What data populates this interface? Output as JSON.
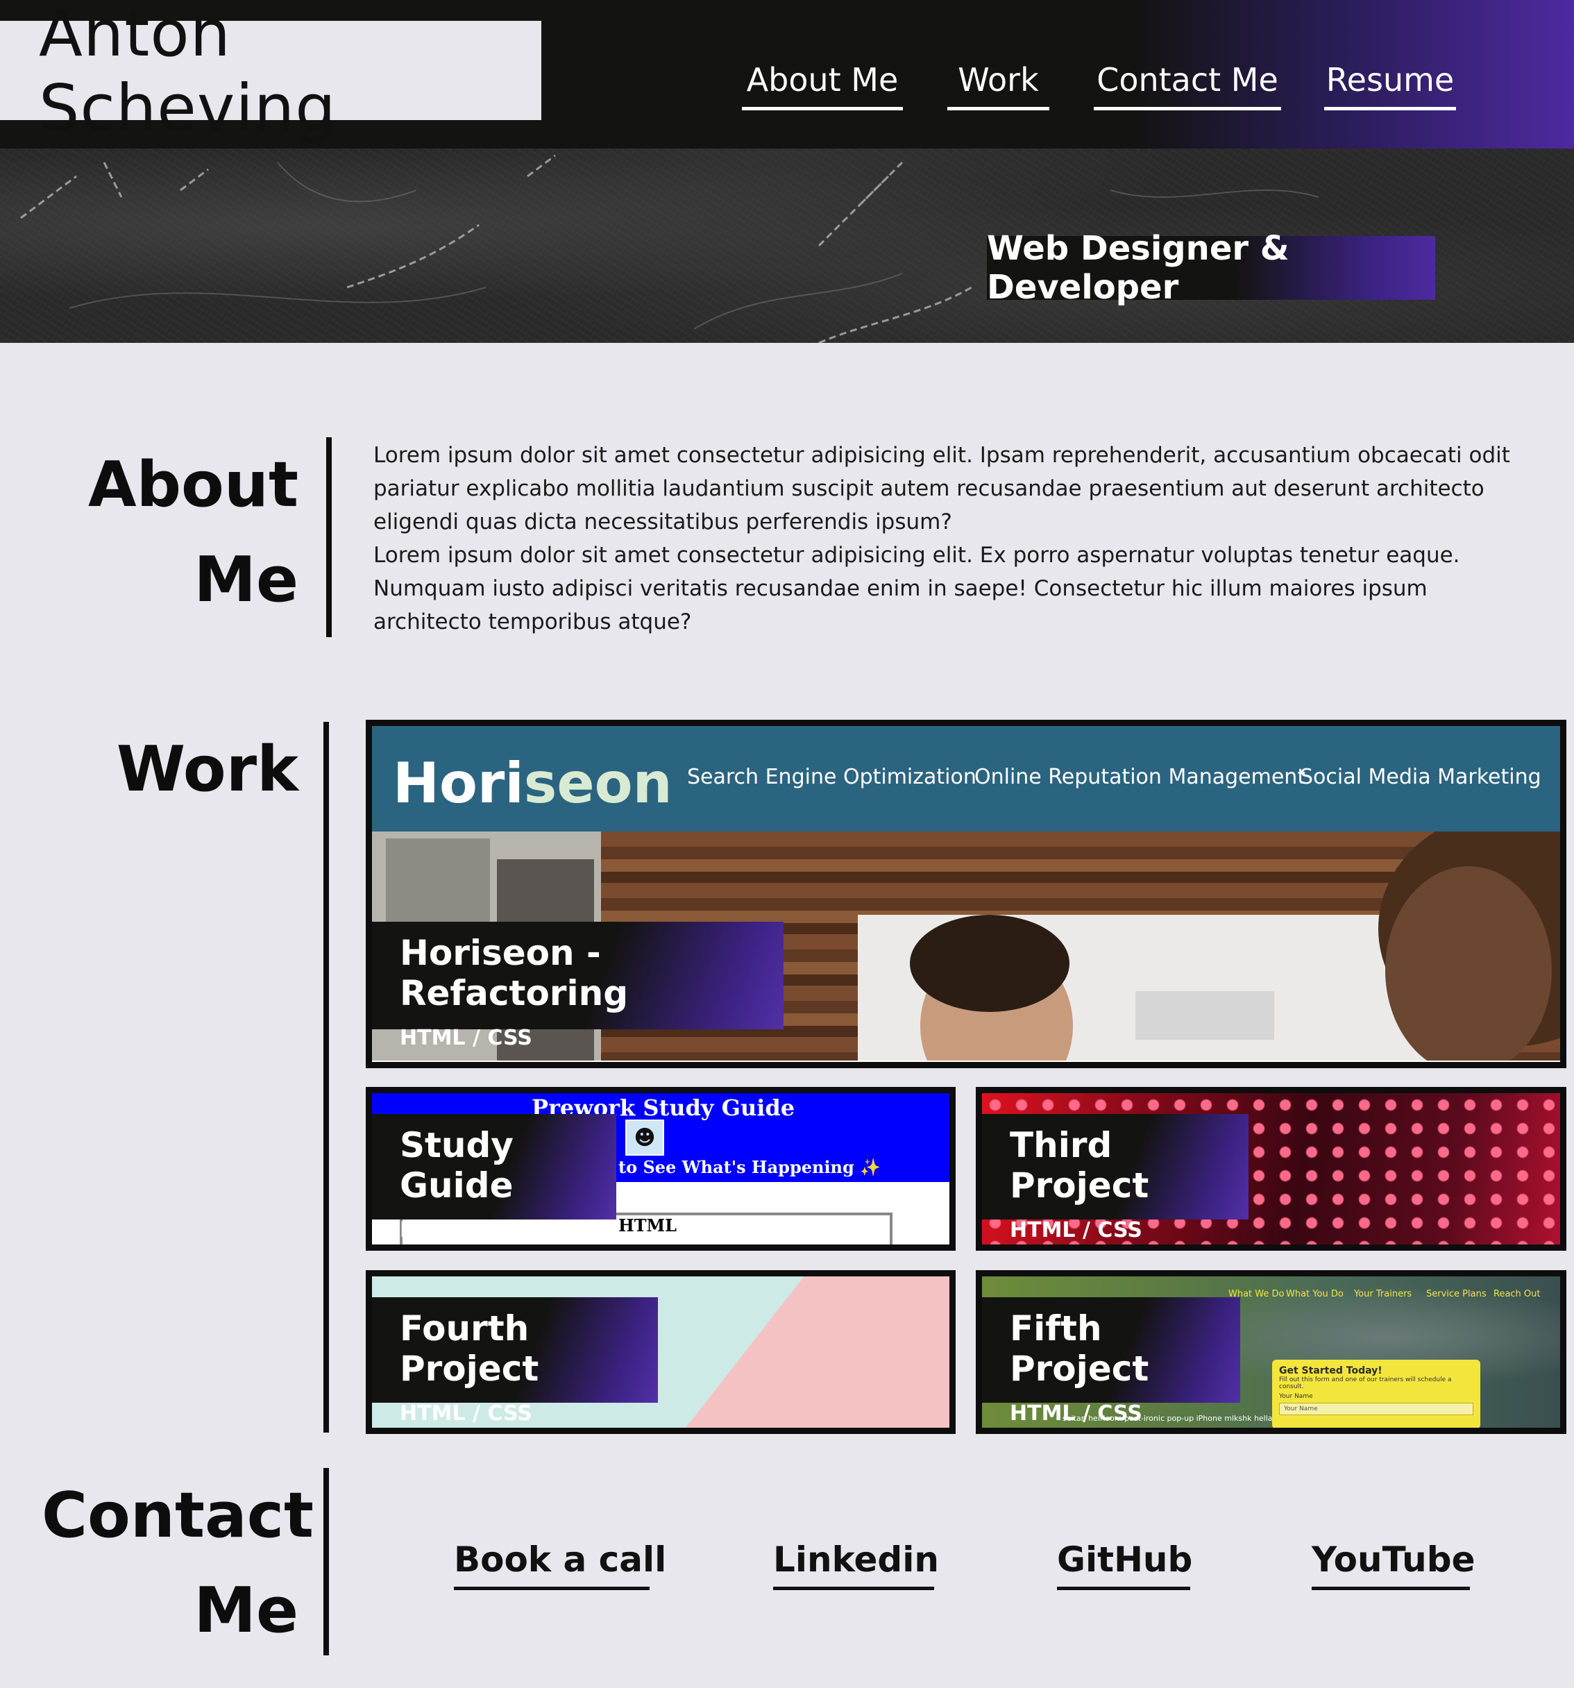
{
  "header": {
    "name": "Anton Scheving",
    "nav": [
      "About Me",
      "Work",
      "Contact Me",
      "Resume"
    ]
  },
  "hero": {
    "tagline": "Web Designer & Developer"
  },
  "about": {
    "title_line1": "About",
    "title_line2": "Me",
    "paragraph1": "Lorem ipsum dolor sit amet consectetur adipisicing elit. Ipsam reprehenderit, accusantium obcaecati odit pariatur explicabo mollitia laudantium suscipit autem recusandae praesentium aut deserunt architecto eligendi quas dicta necessitatibus perferendis ipsum?",
    "paragraph2": "Lorem ipsum dolor sit amet consectetur adipisicing elit. Ex porro aspernatur voluptas tenetur eaque. Numquam iusto adipisci veritatis recusandae enim in saepe! Consectetur hic illum maiores ipsum architecto temporibus atque?"
  },
  "work": {
    "title": "Work",
    "featured": {
      "title": "Horiseon - Refactoring",
      "tech": "HTML / CSS",
      "preview": {
        "logo_a": "Hori",
        "logo_b": "seon",
        "nav": [
          "Search Engine Optimization",
          "Online Reputation Management",
          "Social Media Marketing"
        ]
      }
    },
    "projects": [
      {
        "title": "Study Guide",
        "tech": "HTML / CSS",
        "preview": {
          "heading": "Prework Study Guide",
          "subheading": "to See What's Happening ✨",
          "section": "HTML"
        }
      },
      {
        "title": "Third Project",
        "tech": "HTML / CSS"
      },
      {
        "title": "Fourth Project",
        "tech": "HTML / CSS"
      },
      {
        "title": "Fifth Project",
        "tech": "HTML / CSS",
        "preview": {
          "nav": [
            "What We Do",
            "What You Do",
            "Your Trainers",
            "Service Plans",
            "Reach Out"
          ],
          "form_title": "Get Started Today!",
          "form_text": "Fill out this form and one of our trainers will schedule a consult.",
          "form_label": "Your Name",
          "form_placeholder": "Your Name",
          "footer_text": "seitan heirloom post-ironic pop-up iPhone mlkshk hella"
        }
      }
    ]
  },
  "contact": {
    "title_line1": "Contact",
    "title_line2": "Me",
    "links": [
      "Book a call",
      "Linkedin",
      "GitHub",
      "YouTube"
    ]
  },
  "colors": {
    "background": "#e8e7ed",
    "header_dark": "#131311",
    "accent_purple": "#4d2aa0",
    "horiseon_teal": "#2b6480"
  }
}
